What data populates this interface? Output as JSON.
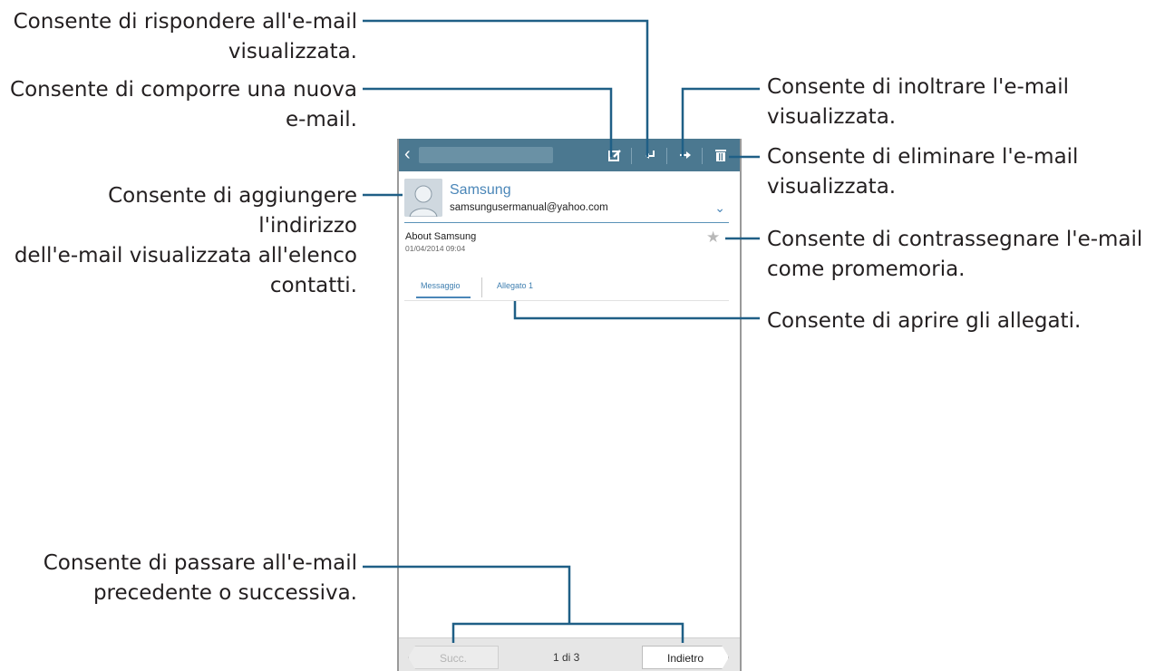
{
  "callouts": {
    "reply": {
      "line1": "Consente di rispondere all'e-mail",
      "line2": "visualizzata."
    },
    "compose": {
      "line1": "Consente di comporre una nuova",
      "line2": "e-mail."
    },
    "add_contact": {
      "line1": "Consente di aggiungere l'indirizzo",
      "line2": "dell'e-mail visualizzata all'elenco",
      "line3": "contatti."
    },
    "prev_next": {
      "line1": "Consente di passare all'e-mail",
      "line2": "precedente o successiva."
    },
    "forward": {
      "line1": "Consente di inoltrare l'e-mail",
      "line2": "visualizzata."
    },
    "delete": {
      "line1": "Consente di eliminare l'e-mail",
      "line2": "visualizzata."
    },
    "star": {
      "line1": "Consente di contrassegnare l'e-mail",
      "line2": "come promemoria."
    },
    "attachments": {
      "line1": "Consente di aprire gli allegati."
    }
  },
  "phone": {
    "toolbar": {
      "back_icon": "chevron-left-icon",
      "compose_icon": "compose-icon",
      "reply_icon": "reply-icon",
      "forward_icon": "forward-icon",
      "delete_icon": "trash-icon"
    },
    "email": {
      "sender_name": "Samsung",
      "sender_email": "samsungusermanual@yahoo.com",
      "subject": "About Samsung",
      "datetime": "01/04/2014  09:04"
    },
    "tabs": [
      "Messaggio",
      "Allegato 1"
    ],
    "bottom": {
      "prev_label": "Succ.",
      "pager": "1 di 3",
      "next_label": "Indietro"
    }
  },
  "colors": {
    "toolbar": "#4b7890",
    "accent": "#4a86b8",
    "leader": "#1f5f86"
  }
}
